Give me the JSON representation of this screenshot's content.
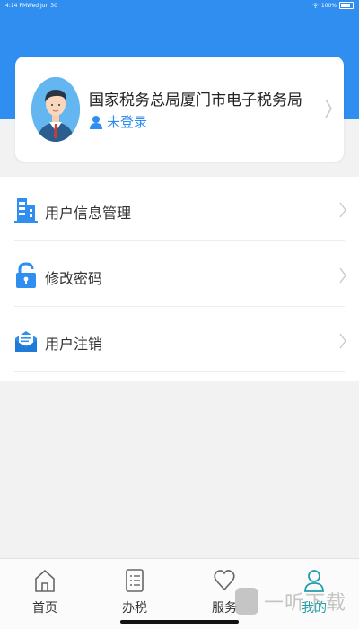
{
  "status_bar": {
    "time": "4:14 PM",
    "date": "Wed Jun 30",
    "battery": "100%"
  },
  "profile": {
    "org_name": "国家税务总局厦门市电子税务局",
    "login_status": "未登录"
  },
  "menu": {
    "items": [
      {
        "label": "用户信息管理",
        "icon": "building-icon"
      },
      {
        "label": "修改密码",
        "icon": "lock-icon"
      },
      {
        "label": "用户注销",
        "icon": "mail-icon"
      }
    ]
  },
  "tabbar": {
    "tabs": [
      {
        "label": "首页",
        "icon": "home-icon",
        "active": false
      },
      {
        "label": "办税",
        "icon": "list-icon",
        "active": false
      },
      {
        "label": "服务",
        "icon": "heart-icon",
        "active": false
      },
      {
        "label": "我的",
        "icon": "user-icon",
        "active": true
      }
    ]
  },
  "watermark": {
    "text": "一听下载"
  },
  "colors": {
    "primary": "#2f8ef0",
    "active_tab": "#1f9fa8",
    "background": "#f2f2f2"
  }
}
